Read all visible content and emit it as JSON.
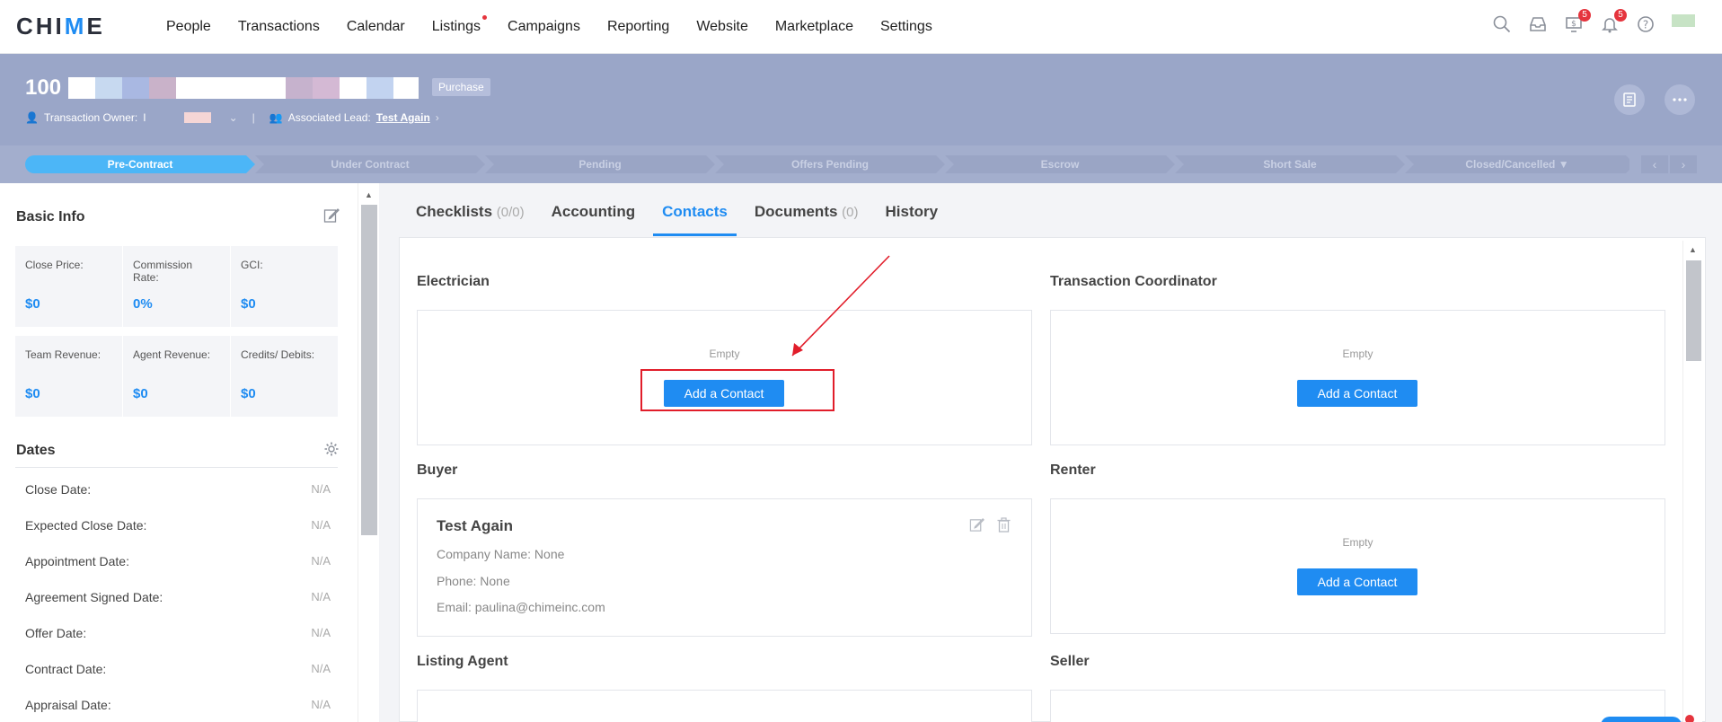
{
  "nav": {
    "logo": "CHIME",
    "items": [
      "People",
      "Transactions",
      "Calendar",
      "Listings",
      "Campaigns",
      "Reporting",
      "Website",
      "Marketplace",
      "Settings"
    ],
    "badges": {
      "dollar": "5",
      "bell": "5"
    }
  },
  "banner": {
    "title": "100",
    "tag": "Purchase",
    "owner_label": "Transaction Owner:",
    "owner_value": "I",
    "lead_label": "Associated Lead:",
    "lead_value": "Test Again"
  },
  "stages": [
    "Pre-Contract",
    "Under Contract",
    "Pending",
    "Offers Pending",
    "Escrow",
    "Short Sale",
    "Closed/Cancelled"
  ],
  "left": {
    "basic_info_title": "Basic Info",
    "row1": [
      {
        "label": "Close Price:",
        "value": "$0"
      },
      {
        "label": "Commission Rate:",
        "value": "0%"
      },
      {
        "label": "GCI:",
        "value": "$0"
      }
    ],
    "row2": [
      {
        "label": "Team Revenue:",
        "value": "$0"
      },
      {
        "label": "Agent Revenue:",
        "value": "$0"
      },
      {
        "label": "Credits/ Debits:",
        "value": "$0"
      }
    ],
    "dates_title": "Dates",
    "dates": [
      {
        "label": "Close Date:",
        "value": "N/A"
      },
      {
        "label": "Expected Close Date:",
        "value": "N/A"
      },
      {
        "label": "Appointment Date:",
        "value": "N/A"
      },
      {
        "label": "Agreement Signed Date:",
        "value": "N/A"
      },
      {
        "label": "Offer Date:",
        "value": "N/A"
      },
      {
        "label": "Contract Date:",
        "value": "N/A"
      },
      {
        "label": "Appraisal Date:",
        "value": "N/A"
      }
    ]
  },
  "tabs": [
    {
      "label": "Checklists",
      "count": "(0/0)"
    },
    {
      "label": "Accounting",
      "count": ""
    },
    {
      "label": "Contacts",
      "count": ""
    },
    {
      "label": "Documents",
      "count": "(0)"
    },
    {
      "label": "History",
      "count": ""
    }
  ],
  "contacts": {
    "electrician": "Electrician",
    "transaction_coordinator": "Transaction Coordinator",
    "buyer": "Buyer",
    "renter": "Renter",
    "listing_agent": "Listing Agent",
    "seller": "Seller",
    "empty": "Empty",
    "add_label": "Add a Contact",
    "buyer_card": {
      "name": "Test Again",
      "company": "Company Name: None",
      "phone": "Phone: None",
      "email": "Email: paulina@chimeinc.com"
    }
  },
  "colors": {
    "accent": "#1f8cf2",
    "banner": "#9aa6c8",
    "active_stage": "#4cb6f7",
    "highlight": "#e11d2a"
  }
}
